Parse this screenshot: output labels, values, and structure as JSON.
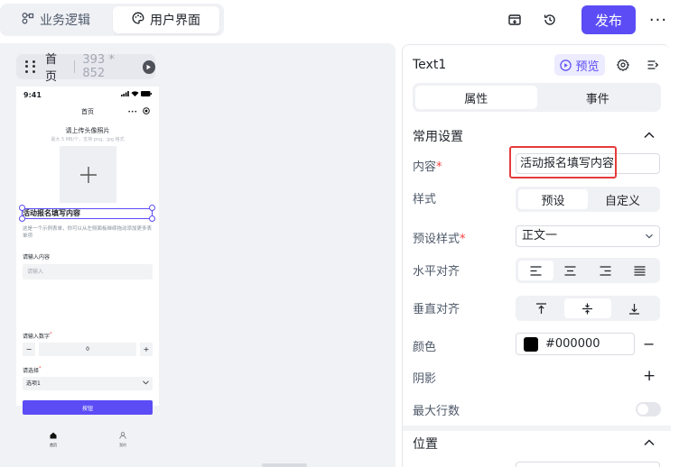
{
  "topbar": {
    "tabs": [
      {
        "label": "业务逻辑",
        "icon": "logic-nodes-icon"
      },
      {
        "label": "用户界面",
        "icon": "palette-icon"
      }
    ],
    "active_tab": "用户界面",
    "publish_label": "发布",
    "more_label": "···"
  },
  "canvas": {
    "page_name": "首页",
    "page_size": "393 * 852",
    "phone": {
      "time": "9:41",
      "title": "首页",
      "capsule_dots": "•••",
      "upload_title": "请上传头像照片",
      "upload_hint": "最大 5 MB/个，支持 png、jpg 格式",
      "selected_text": "活动报名填写内容",
      "description": "这是一个示例表单，你可以从左侧面板继续拖动添加更多表单项",
      "input_label": "请输入内容",
      "input_placeholder": "请输入",
      "number_label": "请输入数字",
      "number_value": "0",
      "minus": "−",
      "plus": "+",
      "select_label": "请选择",
      "select_value": "选项1",
      "button_label": "按钮",
      "tabbar": [
        {
          "label": "首页",
          "icon": "home-icon"
        },
        {
          "label": "我的",
          "icon": "user-icon"
        }
      ],
      "required_mark": "*"
    }
  },
  "panel": {
    "component_name": "Text1",
    "preview_label": "预览",
    "tabs": [
      {
        "label": "属性"
      },
      {
        "label": "事件"
      }
    ],
    "active_tab": "属性",
    "section_common": "常用设置",
    "content_label": "内容",
    "content_value": "活动报名填写内容",
    "style_label": "样式",
    "style_options": [
      "预设",
      "自定义"
    ],
    "style_active": "预设",
    "preset_label": "预设样式",
    "preset_value": "正文一",
    "h_align_label": "水平对齐",
    "v_align_label": "垂直对齐",
    "color_label": "颜色",
    "color_value": "#000000",
    "color_minus": "−",
    "shadow_label": "阴影",
    "shadow_plus": "+",
    "max_lines_label": "最大行数",
    "section_position": "位置",
    "required_mark": "*"
  },
  "colors": {
    "accent": "#5b4cf5",
    "accent_light": "#ecebff",
    "highlight": "#e63b3b",
    "required": "#f53f3f",
    "text_color_swatch": "#000000"
  }
}
